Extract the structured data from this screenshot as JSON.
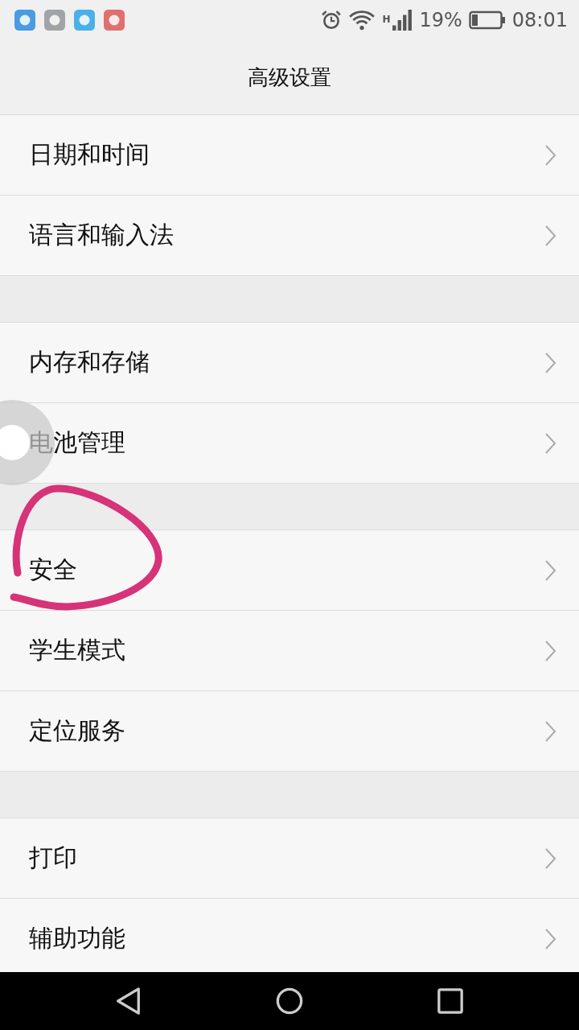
{
  "status_bar": {
    "network": "H",
    "battery": "19%",
    "time": "08:01"
  },
  "title": "高级设置",
  "groups": [
    {
      "items": [
        {
          "label": "日期和时间"
        },
        {
          "label": "语言和输入法"
        }
      ]
    },
    {
      "items": [
        {
          "label": "内存和存储"
        },
        {
          "label": "电池管理"
        }
      ]
    },
    {
      "items": [
        {
          "label": "安全"
        },
        {
          "label": "学生模式"
        },
        {
          "label": "定位服务"
        }
      ]
    },
    {
      "items": [
        {
          "label": "打印"
        },
        {
          "label": "辅助功能"
        }
      ]
    }
  ]
}
